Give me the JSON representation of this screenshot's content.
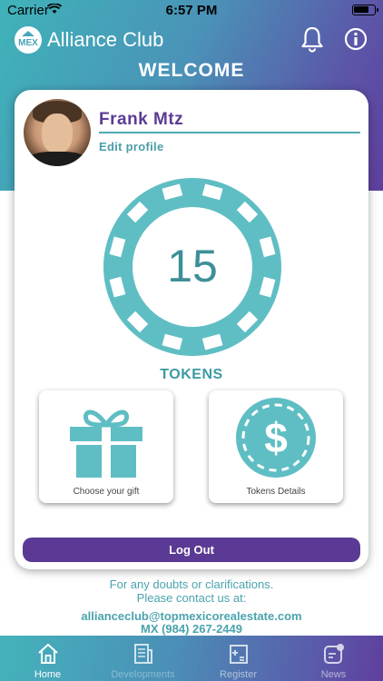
{
  "status_bar": {
    "carrier": "Carrier",
    "time": "6:57 PM"
  },
  "header": {
    "logo_text": "MEX",
    "title": "Alliance Club",
    "welcome": "WELCOME"
  },
  "profile": {
    "name": "Frank  Mtz",
    "edit_label": "Edit profile"
  },
  "tokens": {
    "count": "15",
    "label": "TOKENS"
  },
  "tiles": {
    "gift_label": "Choose your gift",
    "details_label": "Tokens Details"
  },
  "logout_label": "Log Out",
  "contact": {
    "line1": "For any doubts or clarifications.",
    "line2": "Please contact us at:",
    "email": "allianceclub@topmexicorealestate.com",
    "phone": "MX (984) 267-2449"
  },
  "tabs": [
    {
      "label": "Home",
      "icon": "home-icon"
    },
    {
      "label": "Developments",
      "icon": "building-icon"
    },
    {
      "label": "Register",
      "icon": "register-icon"
    },
    {
      "label": "News",
      "icon": "news-icon"
    }
  ],
  "colors": {
    "teal": "#5fbec4",
    "purple": "#5a3a94",
    "accent_text": "#4aa3ae"
  }
}
